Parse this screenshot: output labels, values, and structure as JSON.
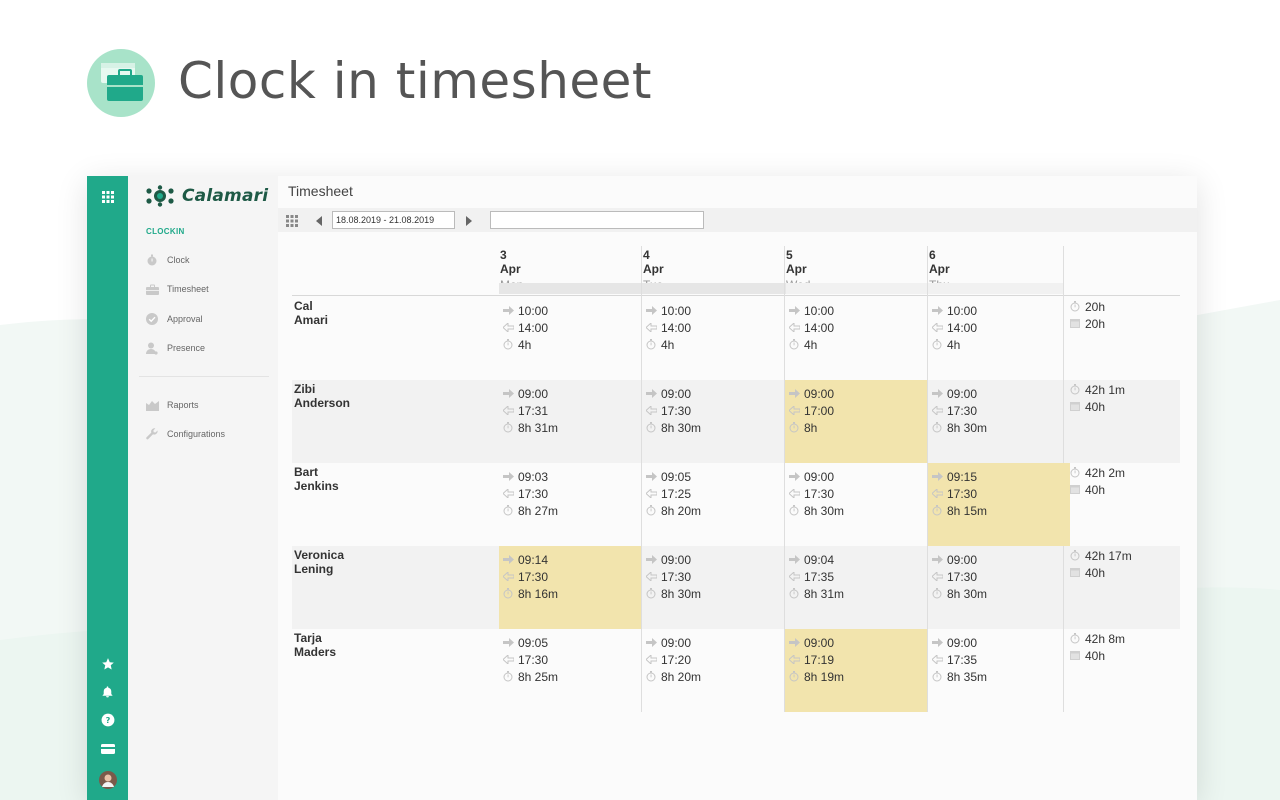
{
  "promo": {
    "title": "Clock in timesheet",
    "accent": "#a8e3c9"
  },
  "brand": {
    "name": "Calamari",
    "color": "#1e5a46",
    "accent": "#20a98a"
  },
  "rail": {
    "icons": [
      "apps-grid-icon",
      "star-icon",
      "bell-icon",
      "help-icon",
      "billing-icon",
      "avatar"
    ]
  },
  "nav": {
    "section": "CLOCKIN",
    "items": [
      {
        "label": "Clock",
        "icon": "stopwatch-icon"
      },
      {
        "label": "Timesheet",
        "icon": "briefcase-icon"
      },
      {
        "label": "Approval",
        "icon": "check-circle-icon"
      },
      {
        "label": "Presence",
        "icon": "person-icon"
      },
      {
        "label": "Raports",
        "icon": "chart-icon"
      },
      {
        "label": "Configurations",
        "icon": "wrench-icon"
      }
    ]
  },
  "page": {
    "title": "Timesheet"
  },
  "toolbar": {
    "date_range": "18.08.2019 - 21.08.2019",
    "search_value": ""
  },
  "columns": [
    {
      "date": "3 Apr",
      "weekday": "Mon"
    },
    {
      "date": "4 Apr",
      "weekday": "Tue"
    },
    {
      "date": "5 Apr",
      "weekday": "Wed"
    },
    {
      "date": "6 Apr",
      "weekday": "Thu"
    }
  ],
  "highlight_color": "#f2e4ad",
  "rows": [
    {
      "name": "Cal Amari",
      "days": [
        {
          "in": "10:00",
          "out": "14:00",
          "total": "4h",
          "highlight": false
        },
        {
          "in": "10:00",
          "out": "14:00",
          "total": "4h",
          "highlight": false
        },
        {
          "in": "10:00",
          "out": "14:00",
          "total": "4h",
          "highlight": false
        },
        {
          "in": "10:00",
          "out": "14:00",
          "total": "4h",
          "highlight": false
        }
      ],
      "summary": {
        "worked": "20h",
        "planned": "20h"
      }
    },
    {
      "name": "Zibi Anderson",
      "days": [
        {
          "in": "09:00",
          "out": "17:31",
          "total": "8h 31m",
          "highlight": false
        },
        {
          "in": "09:00",
          "out": "17:30",
          "total": "8h 30m",
          "highlight": false
        },
        {
          "in": "09:00",
          "out": "17:00",
          "total": "8h",
          "highlight": true
        },
        {
          "in": "09:00",
          "out": "17:30",
          "total": "8h 30m",
          "highlight": false
        }
      ],
      "summary": {
        "worked": "42h 1m",
        "planned": "40h"
      }
    },
    {
      "name": "Bart Jenkins",
      "days": [
        {
          "in": "09:03",
          "out": "17:30",
          "total": "8h 27m",
          "highlight": false
        },
        {
          "in": "09:05",
          "out": "17:25",
          "total": "8h 20m",
          "highlight": false
        },
        {
          "in": "09:00",
          "out": "17:30",
          "total": "8h 30m",
          "highlight": false
        },
        {
          "in": "09:15",
          "out": "17:30",
          "total": "8h 15m",
          "highlight": true
        }
      ],
      "summary": {
        "worked": "42h 2m",
        "planned": "40h"
      }
    },
    {
      "name": "Veronica Lening",
      "days": [
        {
          "in": "09:14",
          "out": "17:30",
          "total": "8h 16m",
          "highlight": true
        },
        {
          "in": "09:00",
          "out": "17:30",
          "total": "8h 30m",
          "highlight": false
        },
        {
          "in": "09:04",
          "out": "17:35",
          "total": "8h 31m",
          "highlight": false
        },
        {
          "in": "09:00",
          "out": "17:30",
          "total": "8h 30m",
          "highlight": false
        }
      ],
      "summary": {
        "worked": "42h 17m",
        "planned": "40h"
      }
    },
    {
      "name": "Tarja Maders",
      "days": [
        {
          "in": "09:05",
          "out": "17:30",
          "total": "8h 25m",
          "highlight": false
        },
        {
          "in": "09:00",
          "out": "17:20",
          "total": "8h 20m",
          "highlight": false
        },
        {
          "in": "09:00",
          "out": "17:19",
          "total": "8h 19m",
          "highlight": true
        },
        {
          "in": "09:00",
          "out": "17:35",
          "total": "8h 35m",
          "highlight": false
        }
      ],
      "summary": {
        "worked": "42h 8m",
        "planned": "40h"
      }
    }
  ]
}
